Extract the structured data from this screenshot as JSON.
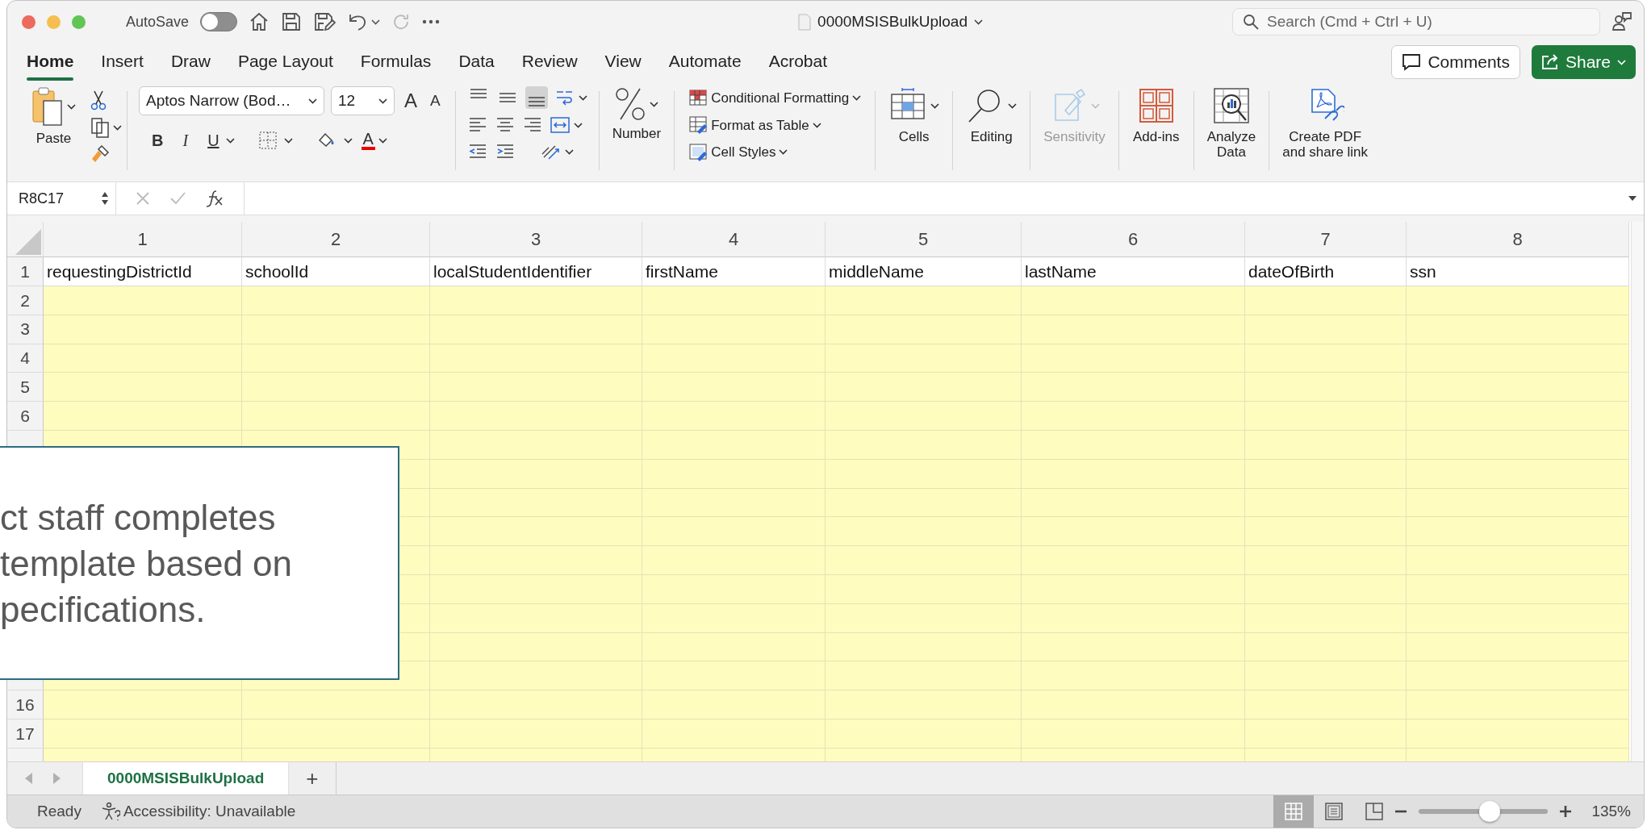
{
  "window": {
    "title": "0000MSISBulkUpload",
    "autosave_label": "AutoSave",
    "autosave_on": false
  },
  "search": {
    "placeholder": "Search (Cmd + Ctrl + U)"
  },
  "tabs": [
    {
      "label": "Home",
      "selected": true
    },
    {
      "label": "Insert",
      "selected": false
    },
    {
      "label": "Draw",
      "selected": false
    },
    {
      "label": "Page Layout",
      "selected": false
    },
    {
      "label": "Formulas",
      "selected": false
    },
    {
      "label": "Data",
      "selected": false
    },
    {
      "label": "Review",
      "selected": false
    },
    {
      "label": "View",
      "selected": false
    },
    {
      "label": "Automate",
      "selected": false
    },
    {
      "label": "Acrobat",
      "selected": false
    }
  ],
  "comments_button": "Comments",
  "share_button": "Share",
  "ribbon": {
    "paste": "Paste",
    "font_name": "Aptos Narrow (Bod…",
    "font_size": "12",
    "grow_font": "A",
    "shrink_font": "A",
    "bold": "B",
    "italic": "I",
    "underline": "U",
    "font_color": "A",
    "number": "Number",
    "alignment": [
      {
        "kind": "top",
        "selected": false
      },
      {
        "kind": "middle",
        "selected": false
      },
      {
        "kind": "bottom",
        "selected": true
      }
    ],
    "styles": [
      {
        "label": "Conditional Formatting",
        "kind": "conditional"
      },
      {
        "label": "Format as Table",
        "kind": "table"
      },
      {
        "label": "Cell Styles",
        "kind": "cellstyles"
      }
    ],
    "groups": [
      {
        "label": "Cells",
        "kind": "cells",
        "disabled": false
      },
      {
        "label": "Editing",
        "kind": "editing",
        "disabled": false
      },
      {
        "label": "Sensitivity",
        "kind": "sensitivity",
        "disabled": true
      },
      {
        "label": "Add-ins",
        "kind": "addins",
        "disabled": false
      },
      {
        "label": "Analyze\nData",
        "kind": "analyze",
        "disabled": false
      },
      {
        "label": "Create PDF\nand share link",
        "kind": "pdf",
        "disabled": false
      }
    ]
  },
  "formula_bar": {
    "name_box": "R8C17"
  },
  "sheet": {
    "columns": [
      "1",
      "2",
      "3",
      "4",
      "5",
      "6",
      "7",
      "8"
    ],
    "header_row": {
      "number": "1",
      "cells": [
        "requestingDistrictId",
        "schoolId",
        "localStudentIdentifier",
        "firstName",
        "middleName",
        "lastName",
        "dateOfBirth",
        "ssn"
      ]
    },
    "rows_before_note": [
      "2",
      "3",
      "4",
      "5",
      "6"
    ],
    "rows_after_note": [
      "16",
      "17"
    ]
  },
  "note": {
    "text": "ct staff completes\ntemplate based on\npecifications."
  },
  "sheet_tabs": [
    {
      "label": "0000MSISBulkUpload",
      "selected": true
    }
  ],
  "add_sheet": "+",
  "status": {
    "ready": "Ready",
    "accessibility": "Accessibility: Unavailable",
    "views": [
      {
        "kind": "normal",
        "selected": true
      },
      {
        "kind": "page_layout",
        "selected": false
      },
      {
        "kind": "page_break",
        "selected": false
      }
    ],
    "zoom": {
      "level": 0.55,
      "reading": "135%"
    }
  }
}
